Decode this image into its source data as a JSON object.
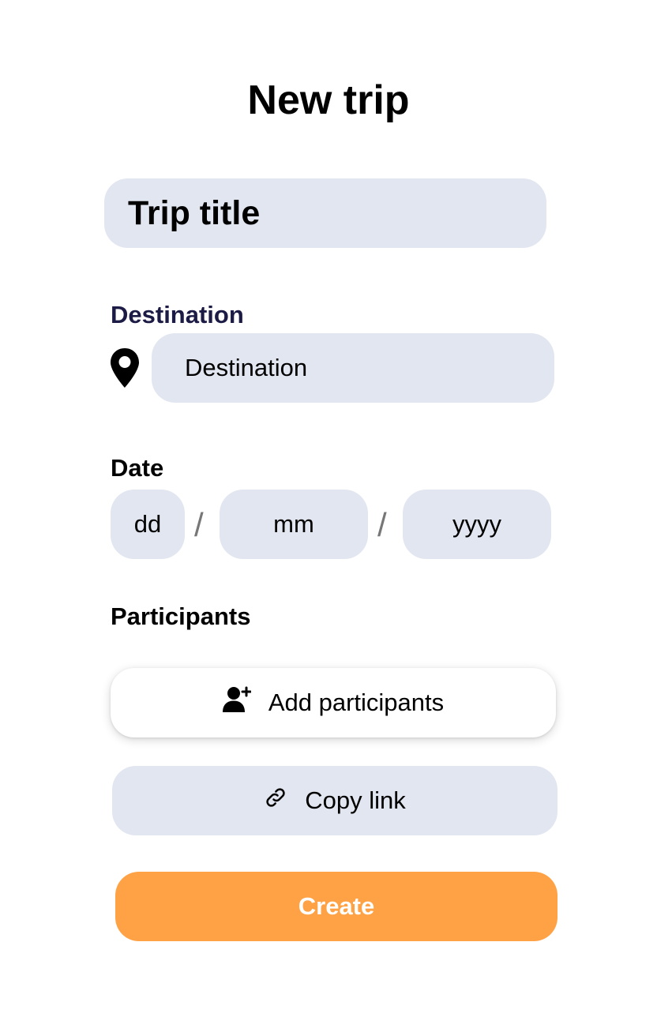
{
  "header": {
    "title": "New trip"
  },
  "form": {
    "trip_title_placeholder": "Trip title",
    "destination": {
      "label": "Destination",
      "placeholder": "Destination",
      "icon": "map-pin-icon"
    },
    "date": {
      "label": "Date",
      "day_placeholder": "dd",
      "month_placeholder": "mm",
      "year_placeholder": "yyyy",
      "separator": "/"
    },
    "participants": {
      "label": "Participants",
      "add_button_label": "Add participants",
      "add_icon": "add-user-icon",
      "copy_link_label": "Copy link",
      "copy_icon": "link-icon"
    },
    "create_button_label": "Create"
  },
  "colors": {
    "field_background": "#e2e6f1",
    "accent": "#ffa245",
    "destination_label": "#1c1b45"
  }
}
